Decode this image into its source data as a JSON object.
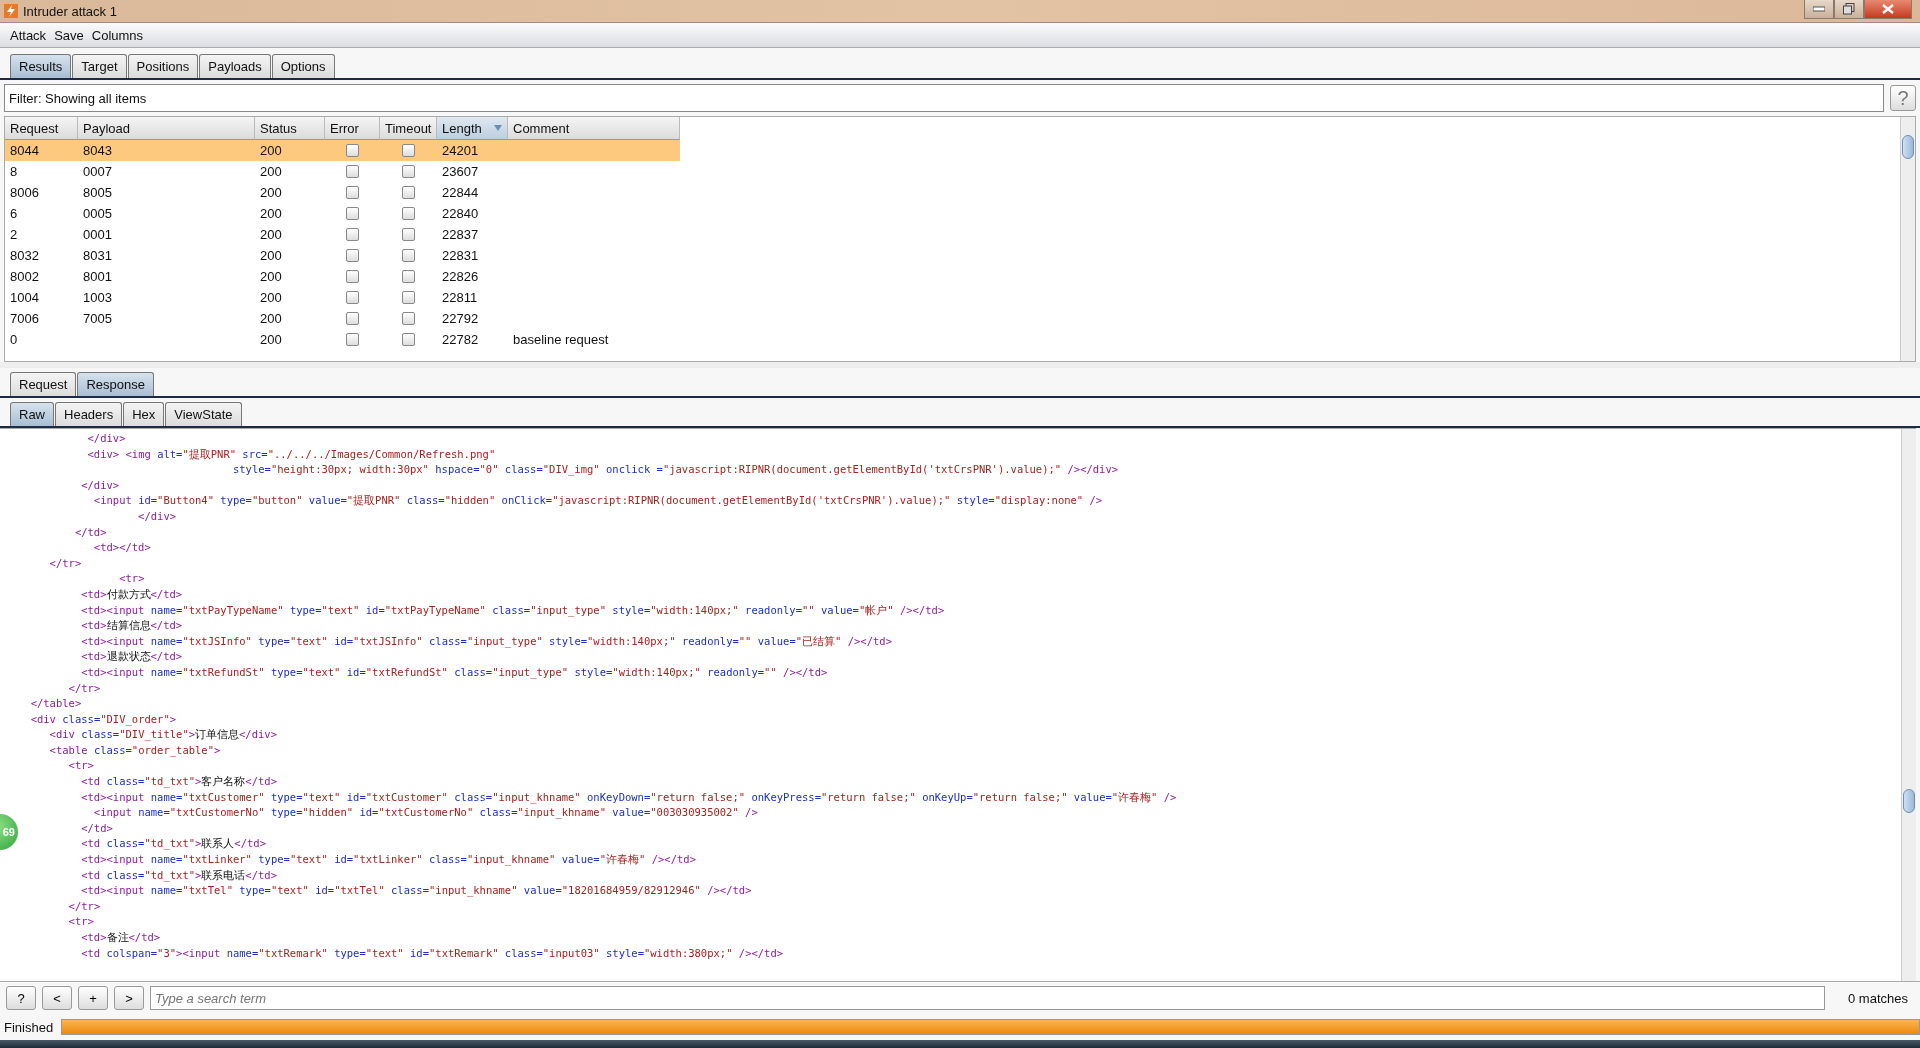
{
  "window": {
    "title": "Intruder attack 1"
  },
  "menu": [
    "Attack",
    "Save",
    "Columns"
  ],
  "tabs": [
    {
      "label": "Results",
      "selected": true
    },
    {
      "label": "Target",
      "selected": false
    },
    {
      "label": "Positions",
      "selected": false
    },
    {
      "label": "Payloads",
      "selected": false
    },
    {
      "label": "Options",
      "selected": false
    }
  ],
  "filter": {
    "text": "Filter: Showing all items",
    "help": "?"
  },
  "table": {
    "columns": [
      {
        "label": "Request",
        "sorted": false
      },
      {
        "label": "Payload",
        "sorted": false
      },
      {
        "label": "Status",
        "sorted": false
      },
      {
        "label": "Error",
        "sorted": false
      },
      {
        "label": "Timeout",
        "sorted": false
      },
      {
        "label": "Length",
        "sorted": true
      },
      {
        "label": "Comment",
        "sorted": false
      }
    ],
    "rows": [
      {
        "request": "8044",
        "payload": "8043",
        "status": "200",
        "error": false,
        "timeout": false,
        "length": "24201",
        "comment": "",
        "selected": true
      },
      {
        "request": "8",
        "payload": "0007",
        "status": "200",
        "error": false,
        "timeout": false,
        "length": "23607",
        "comment": "",
        "selected": false
      },
      {
        "request": "8006",
        "payload": "8005",
        "status": "200",
        "error": false,
        "timeout": false,
        "length": "22844",
        "comment": "",
        "selected": false
      },
      {
        "request": "6",
        "payload": "0005",
        "status": "200",
        "error": false,
        "timeout": false,
        "length": "22840",
        "comment": "",
        "selected": false
      },
      {
        "request": "2",
        "payload": "0001",
        "status": "200",
        "error": false,
        "timeout": false,
        "length": "22837",
        "comment": "",
        "selected": false
      },
      {
        "request": "8032",
        "payload": "8031",
        "status": "200",
        "error": false,
        "timeout": false,
        "length": "22831",
        "comment": "",
        "selected": false
      },
      {
        "request": "8002",
        "payload": "8001",
        "status": "200",
        "error": false,
        "timeout": false,
        "length": "22826",
        "comment": "",
        "selected": false
      },
      {
        "request": "1004",
        "payload": "1003",
        "status": "200",
        "error": false,
        "timeout": false,
        "length": "22811",
        "comment": "",
        "selected": false
      },
      {
        "request": "7006",
        "payload": "7005",
        "status": "200",
        "error": false,
        "timeout": false,
        "length": "22792",
        "comment": "",
        "selected": false
      },
      {
        "request": "0",
        "payload": "",
        "status": "200",
        "error": false,
        "timeout": false,
        "length": "22782",
        "comment": "baseline request",
        "selected": false
      }
    ]
  },
  "message_tabs": [
    {
      "label": "Request",
      "selected": false
    },
    {
      "label": "Response",
      "selected": true
    }
  ],
  "view_tabs": [
    {
      "label": "Raw",
      "selected": true
    },
    {
      "label": "Headers",
      "selected": false
    },
    {
      "label": "Hex",
      "selected": false
    },
    {
      "label": "ViewState",
      "selected": false
    }
  ],
  "code_lines": [
    "           </div>",
    "           <div> <img alt=\"提取PNR\" src=\"../../../Images/Common/Refresh.png\"",
    "                                  style=\"height:30px; width:30px\" hspace=\"0\" class=\"DIV_img\" onclick =\"javascript:RIPNR(document.getElementById('txtCrsPNR').value);\" /></div>",
    "          </div>",
    "            <input id=\"Button4\" type=\"button\" value=\"提取PNR\" class=\"hidden\" onClick=\"javascript:RIPNR(document.getElementById('txtCrsPNR').value);\" style=\"display:none\" />",
    "                   </div>",
    "         </td>",
    "            <td></td>",
    "     </tr>",
    "                <tr>",
    "          <td>付款方式</td>",
    "          <td><input name=\"txtPayTypeName\" type=\"text\" id=\"txtPayTypeName\" class=\"input_type\" style=\"width:140px;\" readonly=\"\" value=\"帐户\" /></td>",
    "          <td>结算信息</td>",
    "          <td><input name=\"txtJSInfo\" type=\"text\" id=\"txtJSInfo\" class=\"input_type\" style=\"width:140px;\" readonly=\"\" value=\"已结算\" /></td>",
    "          <td>退款状态</td>",
    "          <td><input name=\"txtRefundSt\" type=\"text\" id=\"txtRefundSt\" class=\"input_type\" style=\"width:140px;\" readonly=\"\" /></td>",
    "        </tr>",
    "  </table>",
    "  <div class=\"DIV_order\">",
    "     <div class=\"DIV_title\">订单信息</div>",
    "     <table class=\"order_table\">",
    "        <tr>",
    "          <td class=\"td_txt\">客户名称</td>",
    "          <td><input name=\"txtCustomer\" type=\"text\" id=\"txtCustomer\" class=\"input_khname\" onKeyDown=\"return false;\" onKeyPress=\"return false;\" onKeyUp=\"return false;\" value=\"许春梅\" />",
    "            <input name=\"txtCustomerNo\" type=\"hidden\" id=\"txtCustomerNo\" class=\"input_khname\" value=\"003030935002\" />",
    "          </td>",
    "          <td class=\"td_txt\">联系人</td>",
    "          <td><input name=\"txtLinker\" type=\"text\" id=\"txtLinker\" class=\"input_khname\" value=\"许春梅\" /></td>",
    "          <td class=\"td_txt\">联系电话</td>",
    "          <td><input name=\"txtTel\" type=\"text\" id=\"txtTel\" class=\"input_khname\" value=\"18201684959/82912946\" /></td>",
    "        </tr>",
    "        <tr>",
    "          <td>备注</td>",
    "          <td colspan=\"3\"><input name=\"txtRemark\" type=\"text\" id=\"txtRemark\" class=\"input03\" style=\"width:380px;\" /></td>"
  ],
  "side_badge": "69",
  "search": {
    "buttons": [
      "?",
      "<",
      "+",
      ">"
    ],
    "placeholder": "Type a search term",
    "matches": "0 matches"
  },
  "status": {
    "text": "Finished",
    "level": 1
  }
}
